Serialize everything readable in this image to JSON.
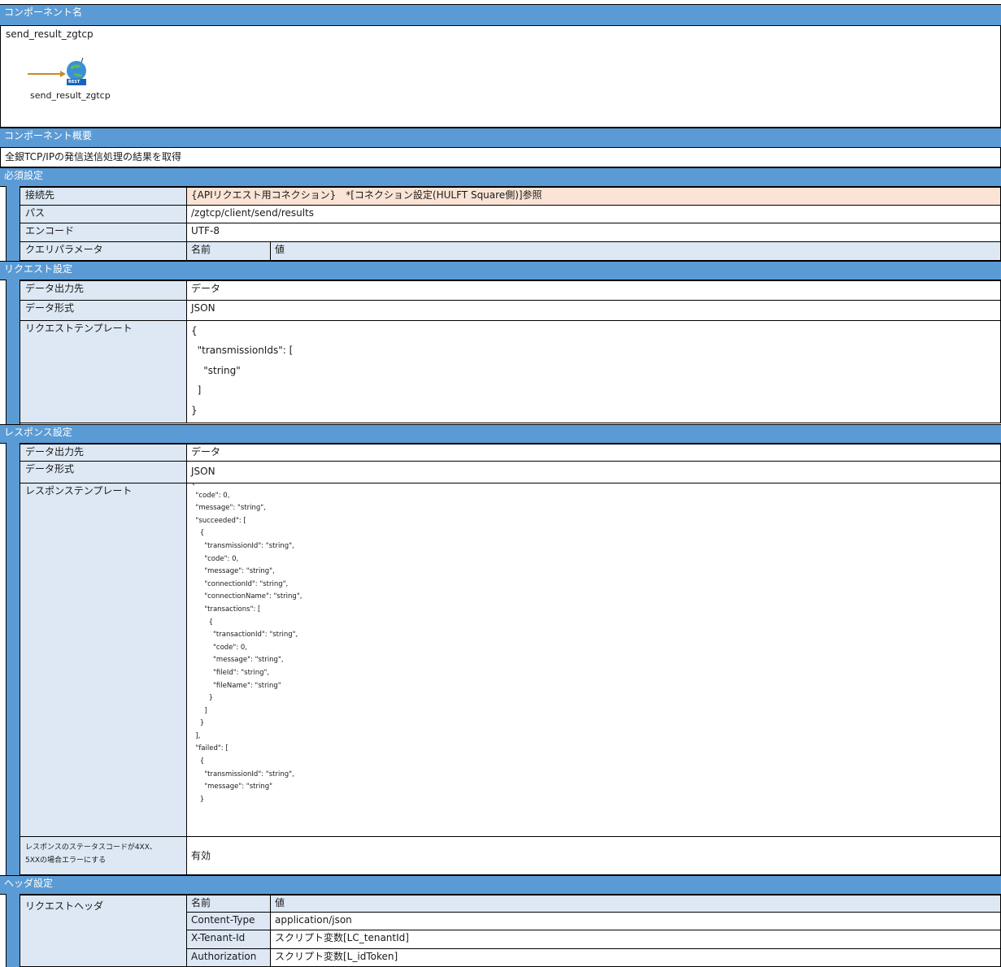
{
  "component_name": {
    "header": "コンポーネント名",
    "value": "send_result_zgtcp",
    "icon_label": "send_result_zgtcp",
    "icon_badge": "REST"
  },
  "component_overview": {
    "header": "コンポーネント概要",
    "value": "全銀TCP/IPの発信送信処理の結果を取得"
  },
  "required": {
    "header": "必須設定",
    "connection_label": "接続先",
    "connection_value": "{APIリクエスト用コネクション}　*[コネクション設定(HULFT Square側)]参照",
    "path_label": "パス",
    "path_value": "/zgtcp/client/send/results",
    "encode_label": "エンコード",
    "encode_value": "UTF-8",
    "query_label": "クエリパラメータ",
    "query_name_col": "名前",
    "query_value_col": "値"
  },
  "request": {
    "header": "リクエスト設定",
    "output_label": "データ出力先",
    "output_value": "データ",
    "format_label": "データ形式",
    "format_value": "JSON",
    "template_label": "リクエストテンプレート",
    "template_value": "{\n  \"transmissionIds\": [\n    \"string\"\n  ]\n}"
  },
  "response": {
    "header": "レスポンス設定",
    "output_label": "データ出力先",
    "output_value": "データ",
    "format_label": "データ形式",
    "format_value": "JSON",
    "template_label": "レスポンステンプレート",
    "template_value": "{\n  \"code\": 0,\n  \"message\": \"string\",\n  \"succeeded\": [\n    {\n      \"transmissionId\": \"string\",\n      \"code\": 0,\n      \"message\": \"string\",\n      \"connectionId\": \"string\",\n      \"connectionName\": \"string\",\n      \"transactions\": [\n        {\n          \"transactionId\": \"string\",\n          \"code\": 0,\n          \"message\": \"string\",\n          \"fileId\": \"string\",\n          \"fileName\": \"string\"\n        }\n      ]\n    }\n  ],\n  \"failed\": [\n    {\n      \"transmissionId\": \"string\",\n      \"message\": \"string\"\n    }",
    "error_label_line1": "レスポンスのステータスコードが4XX、",
    "error_label_line2": "5XXの場合エラーにする",
    "error_value": "有効"
  },
  "header_settings": {
    "header": "ヘッダ設定",
    "request_header_label": "リクエストヘッダ",
    "name_col": "名前",
    "value_col": "値",
    "rows": [
      {
        "name": "Content-Type",
        "value": "application/json"
      },
      {
        "name": "X-Tenant-Id",
        "value": "スクリプト変数[LC_tenantId]"
      },
      {
        "name": "Authorization",
        "value": "スクリプト変数[L_idToken]"
      }
    ]
  },
  "colors": {
    "section_header": "#5b9bd5",
    "label_cell": "#dde8f4",
    "highlight_cell": "#fbe4d5"
  }
}
